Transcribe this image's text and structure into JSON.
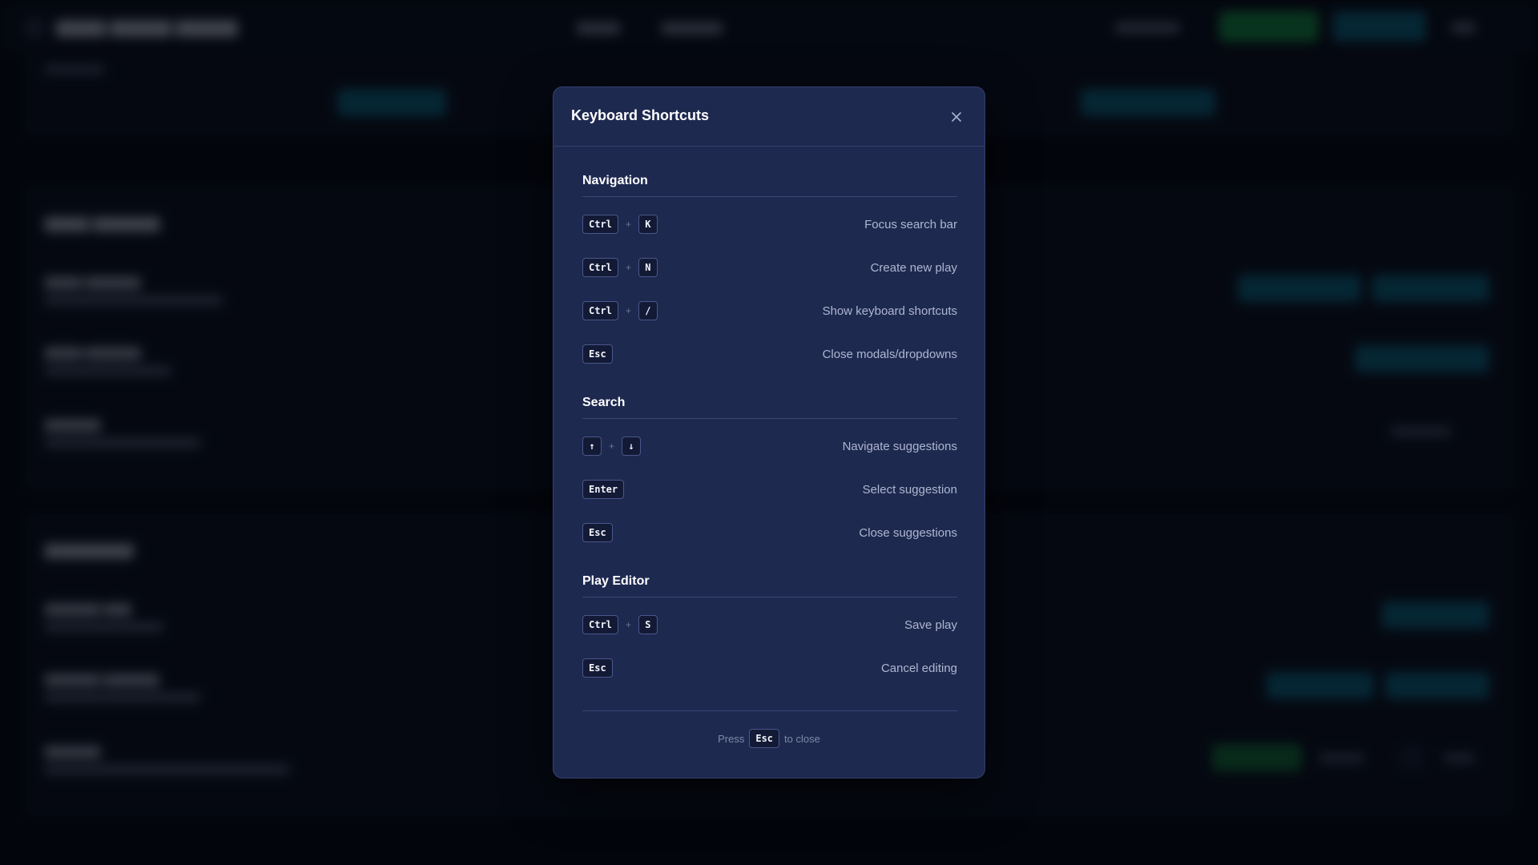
{
  "modal": {
    "title": "Keyboard Shortcuts",
    "close_icon": "close-icon",
    "sections": [
      {
        "title": "Navigation",
        "shortcuts": [
          {
            "keys": [
              "Ctrl",
              "K"
            ],
            "description": "Focus search bar"
          },
          {
            "keys": [
              "Ctrl",
              "N"
            ],
            "description": "Create new play"
          },
          {
            "keys": [
              "Ctrl",
              "/"
            ],
            "description": "Show keyboard shortcuts"
          },
          {
            "keys": [
              "Esc"
            ],
            "description": "Close modals/dropdowns"
          }
        ]
      },
      {
        "title": "Search",
        "shortcuts": [
          {
            "keys": [
              "↑",
              "↓"
            ],
            "description": "Navigate suggestions"
          },
          {
            "keys": [
              "Enter"
            ],
            "description": "Select suggestion"
          },
          {
            "keys": [
              "Esc"
            ],
            "description": "Close suggestions"
          }
        ]
      },
      {
        "title": "Play Editor",
        "shortcuts": [
          {
            "keys": [
              "Ctrl",
              "S"
            ],
            "description": "Save play"
          },
          {
            "keys": [
              "Esc"
            ],
            "description": "Cancel editing"
          }
        ]
      }
    ],
    "key_separator": "+",
    "footer": {
      "prefix": "Press",
      "key": "Esc",
      "suffix": "to close"
    }
  },
  "colors": {
    "modal_bg": "#1e2950",
    "backdrop": "#05070d",
    "accent_green": "#16a34a",
    "accent_cyan": "#0e7490"
  }
}
